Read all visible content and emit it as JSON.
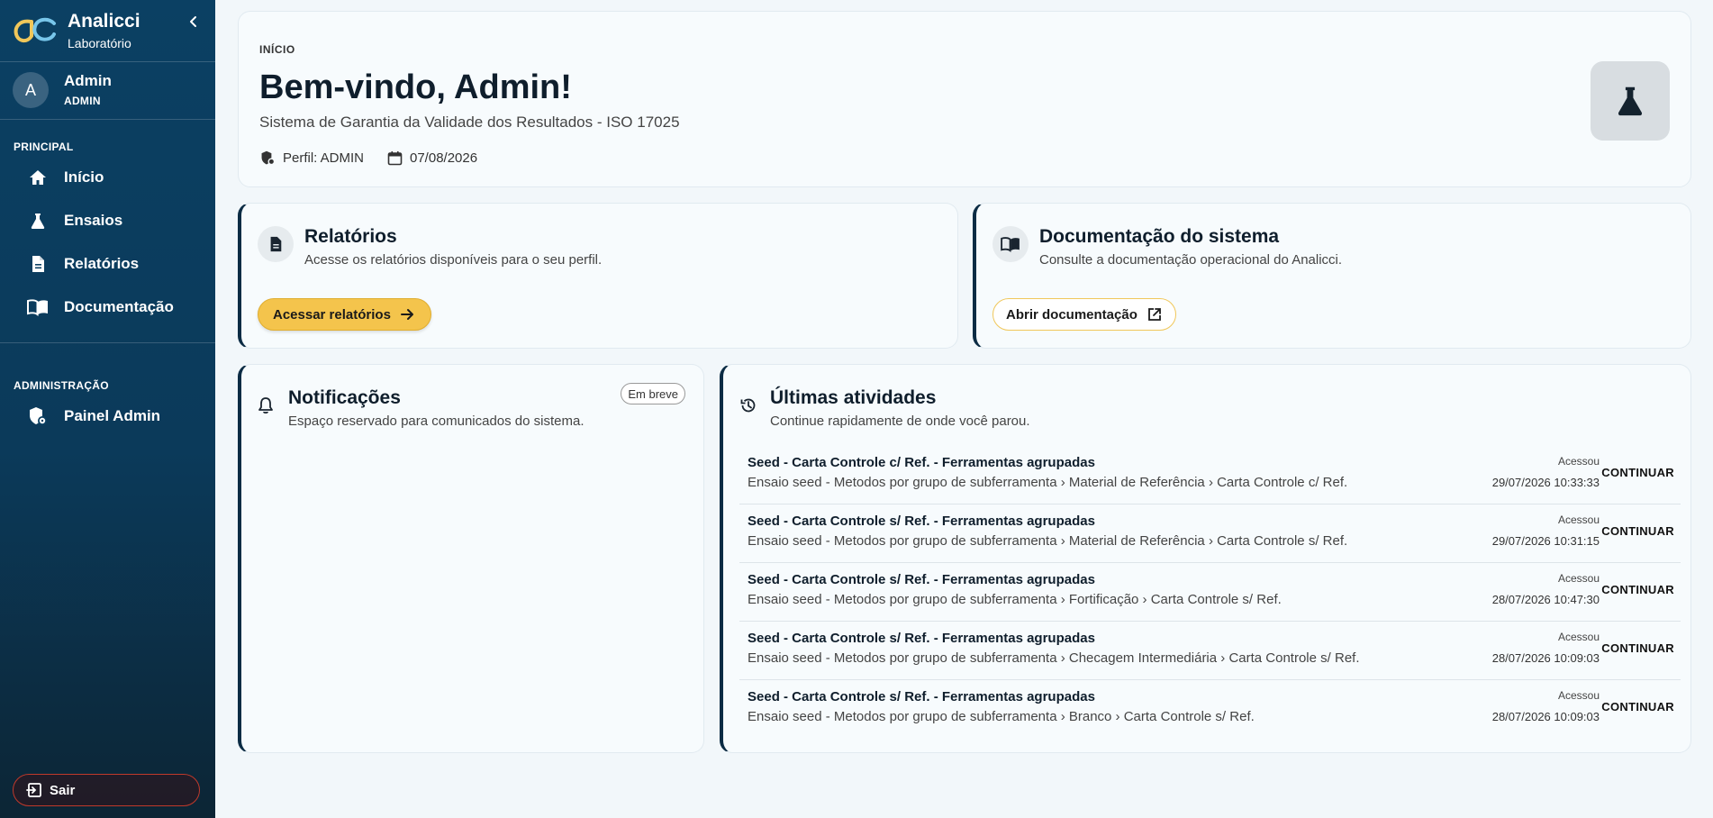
{
  "app": {
    "brand_name": "Analicci",
    "brand_sub": "Laboratório"
  },
  "user": {
    "initial": "A",
    "name": "Admin",
    "role": "ADMIN"
  },
  "sidebar": {
    "principal_label": "PRINCIPAL",
    "items": [
      {
        "label": "Início",
        "icon": "home-icon"
      },
      {
        "label": "Ensaios",
        "icon": "flask-icon"
      },
      {
        "label": "Relatórios",
        "icon": "document-icon"
      },
      {
        "label": "Documentação",
        "icon": "book-icon"
      }
    ],
    "admin_label": "ADMINISTRAÇÃO",
    "admin_items": [
      {
        "label": "Painel Admin",
        "icon": "shield-gear-icon"
      }
    ],
    "logout_label": "Sair"
  },
  "hero": {
    "breadcrumb": "INÍCIO",
    "title": "Bem-vindo, Admin!",
    "subtitle": "Sistema de Garantia da Validade dos Resultados - ISO 17025",
    "profile": "Perfil: ADMIN",
    "date": "07/08/2026"
  },
  "reports_card": {
    "title": "Relatórios",
    "description": "Acesse os relatórios disponíveis para o seu perfil.",
    "button": "Acessar relatórios"
  },
  "docs_card": {
    "title": "Documentação do sistema",
    "description": "Consulte a documentação operacional do Analicci.",
    "button": "Abrir documentação"
  },
  "notifications": {
    "title": "Notificações",
    "description": "Espaço reservado para comunicados do sistema.",
    "badge": "Em breve"
  },
  "activities": {
    "title": "Últimas atividades",
    "description": "Continue rapidamente de onde você parou.",
    "continue_label": "CONTINUAR",
    "items": [
      {
        "title": "Seed - Carta Controle c/ Ref. - Ferramentas agrupadas",
        "path": "Ensaio seed - Metodos por grupo de subferramenta › Material de Referência › Carta Controle c/ Ref.",
        "when": "Acessou",
        "date": "29/07/2026 10:33:33"
      },
      {
        "title": "Seed - Carta Controle s/ Ref. - Ferramentas agrupadas",
        "path": "Ensaio seed - Metodos por grupo de subferramenta › Material de Referência › Carta Controle s/ Ref.",
        "when": "Acessou",
        "date": "29/07/2026 10:31:15"
      },
      {
        "title": "Seed - Carta Controle s/ Ref. - Ferramentas agrupadas",
        "path": "Ensaio seed - Metodos por grupo de subferramenta › Fortificação › Carta Controle s/ Ref.",
        "when": "Acessou",
        "date": "28/07/2026 10:47:30"
      },
      {
        "title": "Seed - Carta Controle s/ Ref. - Ferramentas agrupadas",
        "path": "Ensaio seed - Metodos por grupo de subferramenta › Checagem Intermediária › Carta Controle s/ Ref.",
        "when": "Acessou",
        "date": "28/07/2026 10:09:03"
      },
      {
        "title": "Seed - Carta Controle s/ Ref. - Ferramentas agrupadas",
        "path": "Ensaio seed - Metodos por grupo de subferramenta › Branco › Carta Controle s/ Ref.",
        "when": "Acessou",
        "date": "28/07/2026 10:09:03"
      }
    ]
  },
  "colors": {
    "sidebar": "#0b4063",
    "accent_yellow": "#f4c44c",
    "card_accent": "#0c2c44",
    "logout_border": "#c0392b"
  }
}
